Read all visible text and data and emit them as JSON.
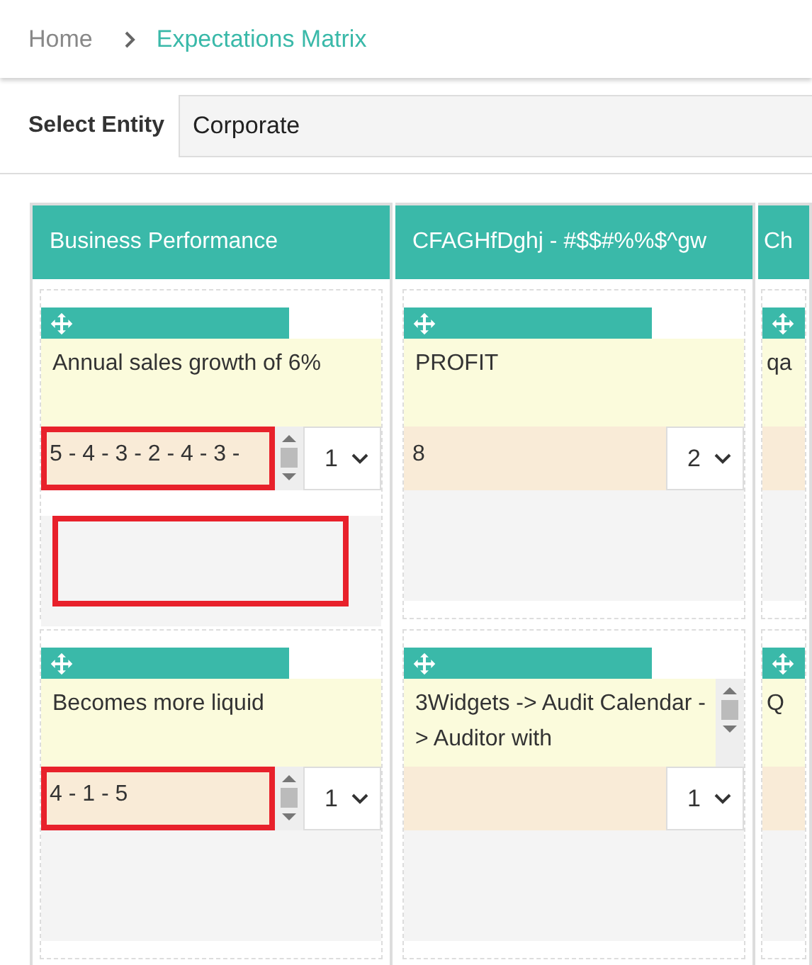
{
  "breadcrumb": [
    {
      "label": "Home",
      "current": false
    },
    {
      "label": "Expectations Matrix",
      "current": true
    }
  ],
  "entity": {
    "label": "Select Entity",
    "value": "Corporate"
  },
  "columns": [
    {
      "title": "Business Performance",
      "cards": [
        {
          "text": "Annual sales growth of 6%",
          "score": "5 - 4 - 3 - 2 - 4 - 3 -",
          "score_scrollbar": true,
          "score_marked": true,
          "rank": "1",
          "note_marked": true
        },
        {
          "text": "Becomes more liquid",
          "score": "4 - 1 - 5",
          "score_scrollbar": true,
          "score_marked": true,
          "rank": "1"
        }
      ]
    },
    {
      "title": "CFAGHfDghj - #$$#%%$^gw",
      "cards": [
        {
          "text": "PROFIT",
          "score": "8",
          "rank": "2"
        },
        {
          "text": "3Widgets -> Audit Calendar -> Auditor with",
          "text_scrollbar": true,
          "rank": "1"
        }
      ]
    },
    {
      "title": "Ch",
      "cards": [
        {
          "text": "qa"
        },
        {
          "text": "Q"
        }
      ]
    }
  ]
}
